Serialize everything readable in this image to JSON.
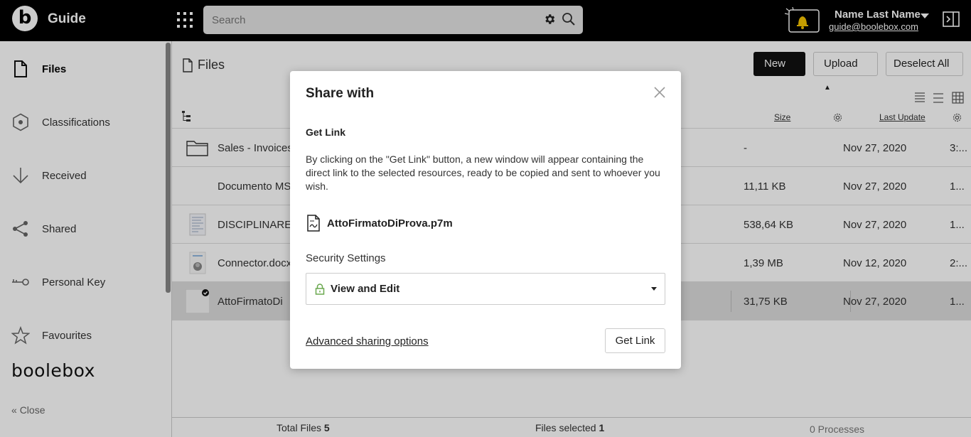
{
  "topbar": {
    "logo_letter": "b",
    "app_title": "Guide",
    "search_placeholder": "Search",
    "user_name": "Name Last Name",
    "user_email": "guide@boolebox.com"
  },
  "sidebar": {
    "items": [
      {
        "label": "Files",
        "icon": "file-icon",
        "active": true
      },
      {
        "label": "Classifications",
        "icon": "hexagon-icon"
      },
      {
        "label": "Received",
        "icon": "arrow-down-icon"
      },
      {
        "label": "Shared",
        "icon": "share-icon"
      },
      {
        "label": "Personal Key",
        "icon": "key-icon"
      },
      {
        "label": "Favourites",
        "icon": "star-icon"
      }
    ],
    "brand": "boolebox",
    "close_label": "Close"
  },
  "main": {
    "title": "Files",
    "buttons": {
      "new": "New",
      "upload": "Upload",
      "deselect": "Deselect All"
    },
    "columns": {
      "size": "Size",
      "last_update": "Last Update"
    },
    "rows": [
      {
        "name": "Sales - Invoices",
        "size": "-",
        "date": "Nov 27, 2020",
        "extra": "3:...",
        "thumb": "folder-icon"
      },
      {
        "name": "Documento MS",
        "size": "11,11 KB",
        "date": "Nov 27, 2020",
        "extra": "1...",
        "thumb": "none"
      },
      {
        "name": "DISCIPLINARE",
        "size": "538,64 KB",
        "date": "Nov 27, 2020",
        "extra": "1...",
        "thumb": "document-thumbnail"
      },
      {
        "name": "Connector.docx",
        "size": "1,39 MB",
        "date": "Nov 12, 2020",
        "extra": "2:...",
        "thumb": "document-thumbnail"
      },
      {
        "name": "AttoFirmatoDi",
        "size": "31,75 KB",
        "date": "Nov 27, 2020",
        "extra": "1...",
        "thumb": "selected-file-thumbnail",
        "selected": true
      }
    ],
    "footer": {
      "total_label": "Total Files",
      "total_value": "5",
      "selected_label": "Files selected",
      "selected_value": "1",
      "processes": "0 Processes"
    }
  },
  "modal": {
    "title": "Share with",
    "subtitle": "Get Link",
    "description": "By clicking on the \"Get Link\" button, a new window will appear containing the direct link to the selected resources, ready to be copied and sent to whoever you wish.",
    "file_name": "AttoFirmatoDiProva.p7m",
    "security_label": "Security Settings",
    "security_value": "View and Edit",
    "advanced_link": "Advanced sharing options",
    "get_link_button": "Get Link"
  },
  "colors": {
    "topbar": "#000000",
    "bell_accent": "#f5c400",
    "lock_accent": "#6aa84f",
    "selected_row": "#dcdcdc"
  }
}
